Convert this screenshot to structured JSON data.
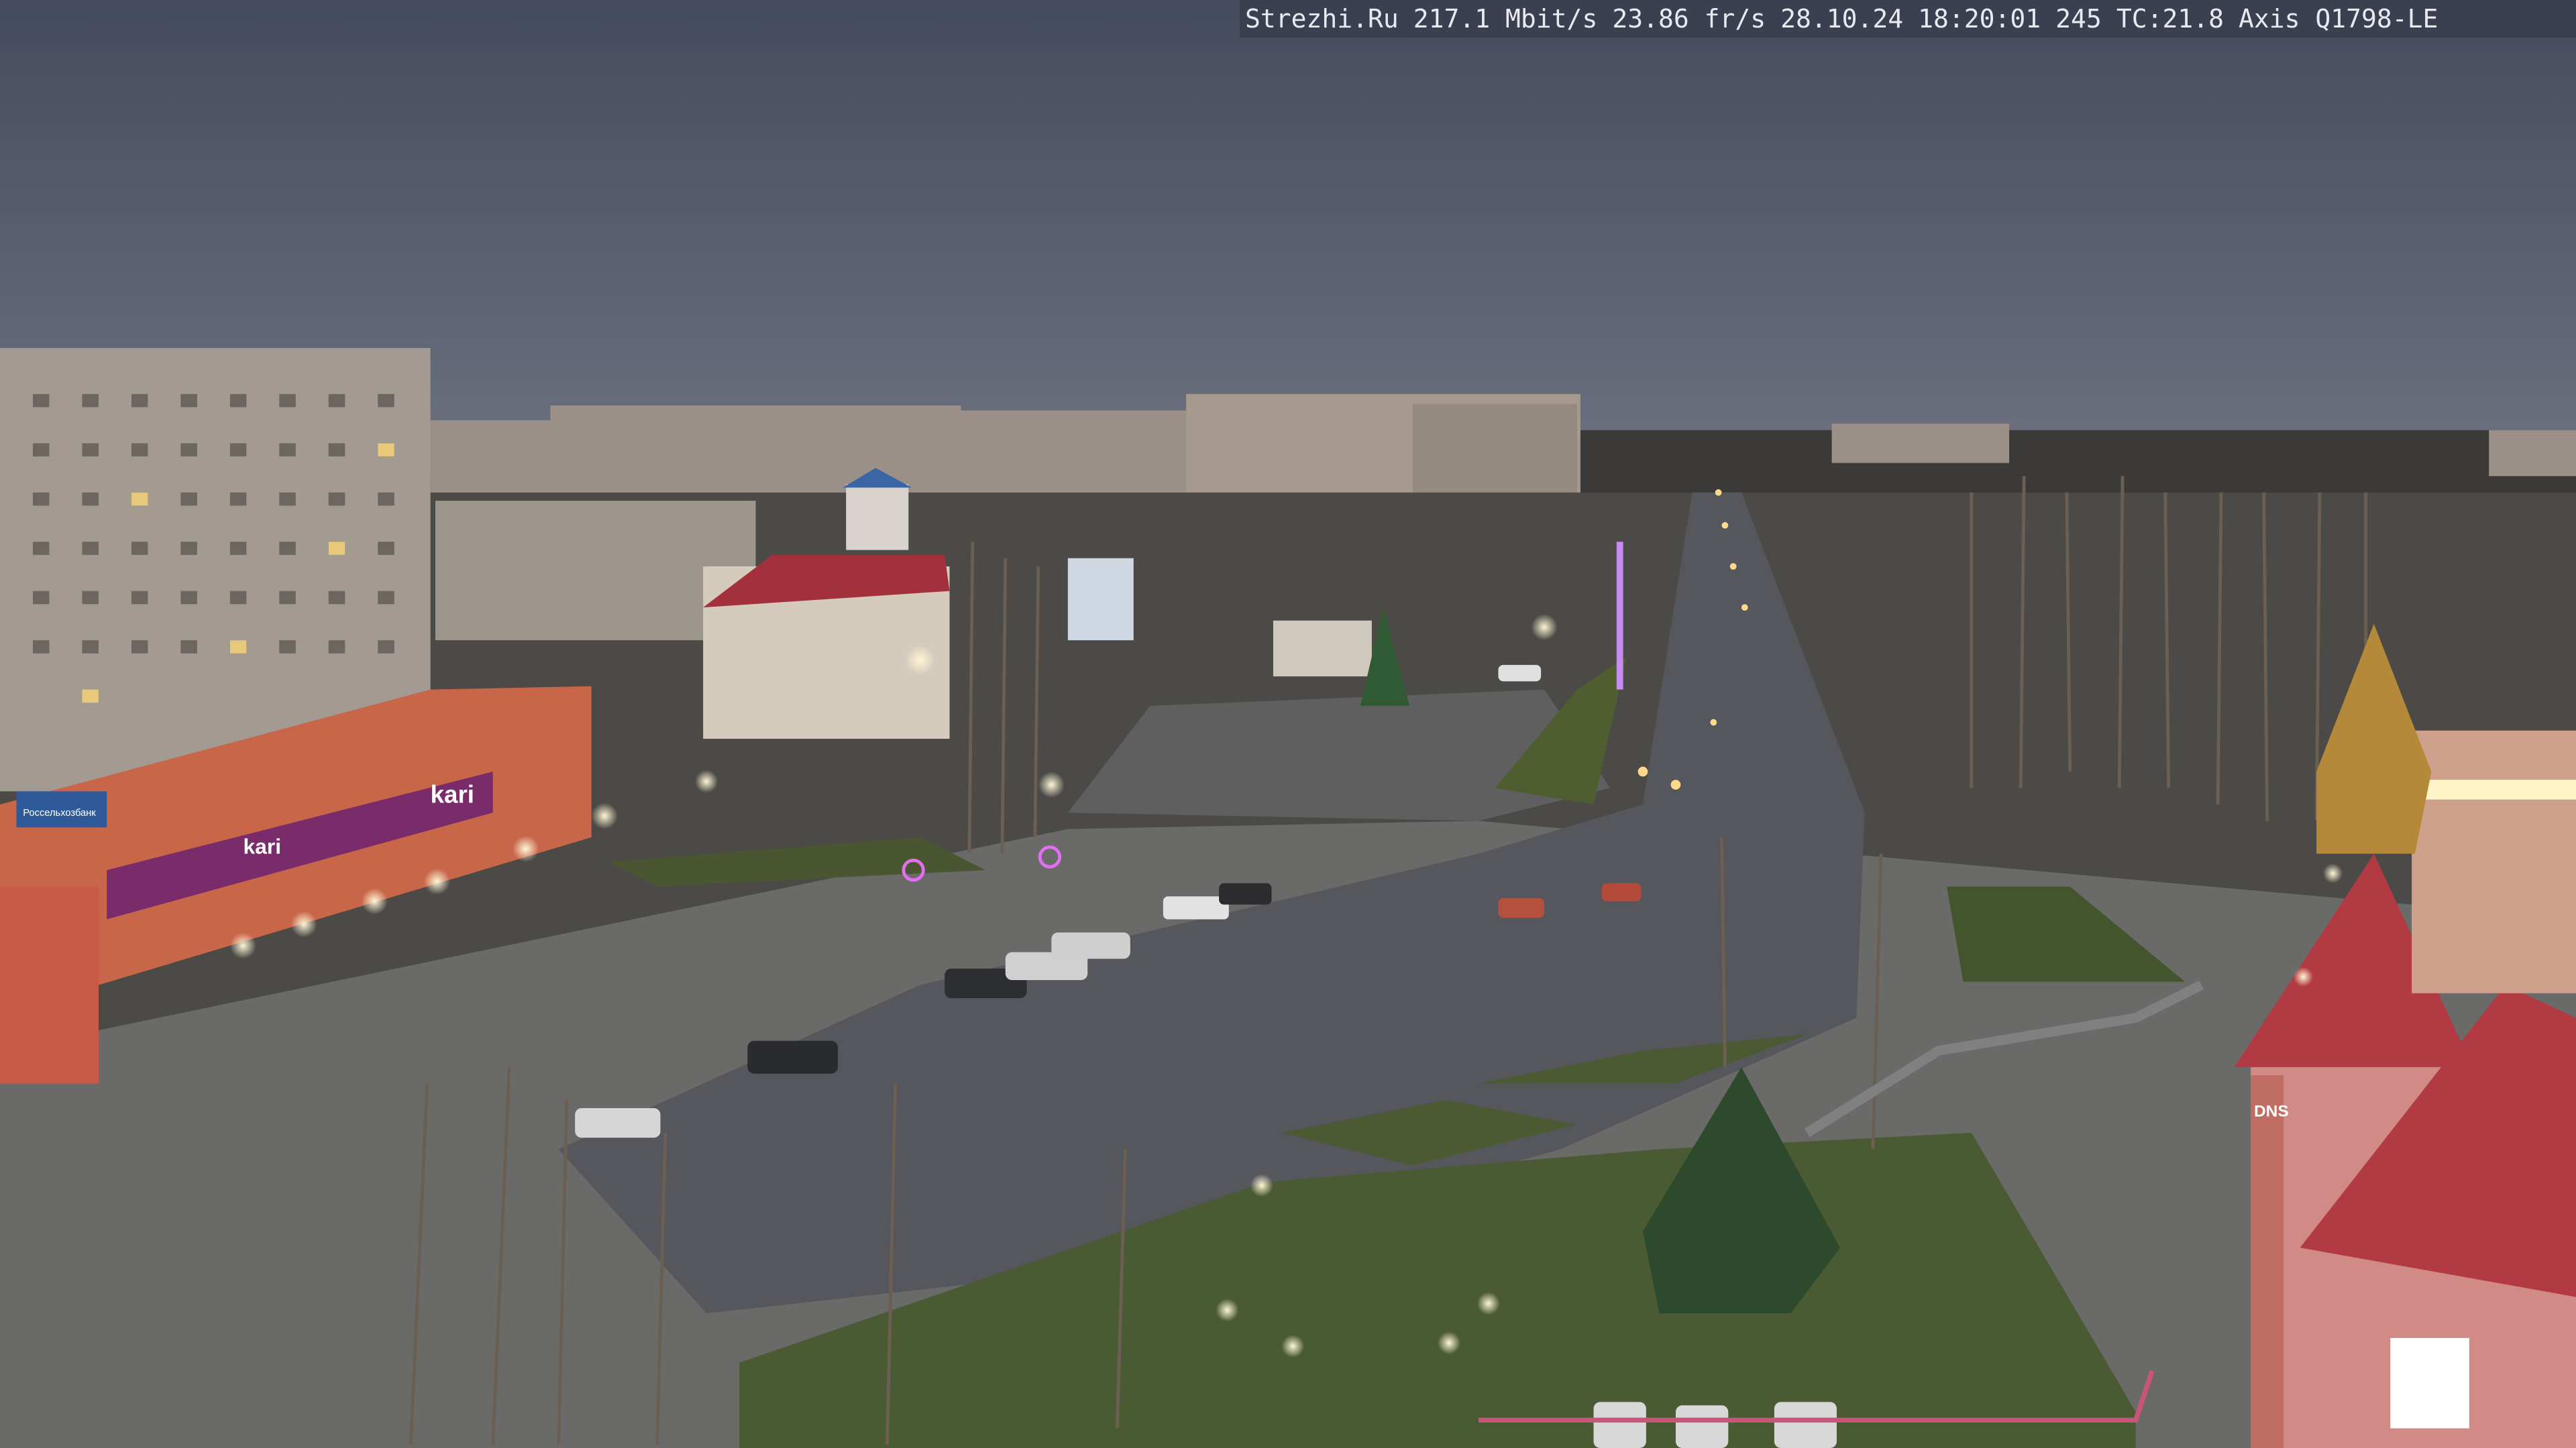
{
  "overlay": {
    "site": "Strezhi.Ru",
    "bitrate": "217.1 Mbit/s",
    "framerate": "23.86 fr/s",
    "date": "28.10.24",
    "time": "18:20:01",
    "counter": "245",
    "tc": "TC:21.8",
    "camera": "Axis Q1798-LE"
  },
  "signs": {
    "store_left": "kari",
    "store_lower": "kari",
    "bank": "Россельхозбанк",
    "store_right": "DNS"
  },
  "colors": {
    "sky_top": "#454b5e",
    "sky_horizon": "#6d7280",
    "road": "#55575c",
    "grass": "#4a5a32",
    "building": "#a39b92",
    "roof_red": "#b23a43",
    "lamp": "#fff2c4"
  }
}
